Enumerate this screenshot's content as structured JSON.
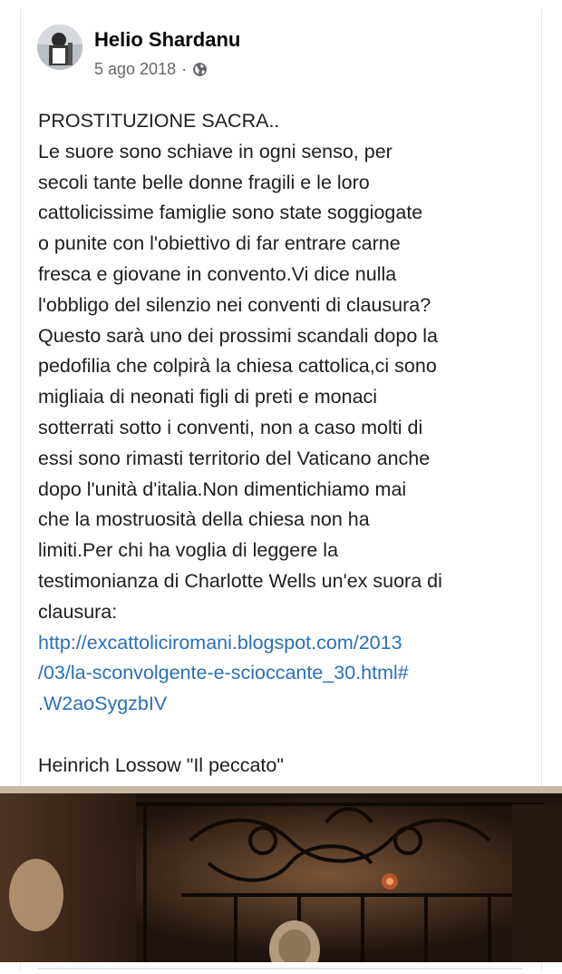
{
  "post": {
    "author": "Helio Shardanu",
    "date": "5 ago 2018",
    "separator": "·",
    "privacy_icon": "globe-icon",
    "text_lines": [
      "PROSTITUZIONE SACRA..",
      "Le suore sono schiave in ogni senso, per",
      "secoli tante belle donne fragili e le loro",
      "cattolicissime famiglie sono state soggiogate",
      "o punite con l'obiettivo di far entrare carne",
      "fresca e giovane in convento.Vi dice nulla",
      "l'obbligo del silenzio nei conventi di clausura?",
      "Questo sarà uno dei prossimi scandali dopo la",
      "pedofilia che colpirà la chiesa cattolica,ci sono",
      "migliaia di neonati figli di preti e monaci",
      "sotterrati sotto i conventi, non a caso molti di",
      "essi sono rimasti territorio del Vaticano anche",
      "dopo l'unità d'italia.Non dimentichiamo mai",
      "che la mostruosità della chiesa non ha",
      "limiti.Per chi ha voglia di leggere la",
      "testimonianza di Charlotte Wells un'ex suora di",
      "clausura:"
    ],
    "link_lines": [
      "http://excattoliciromani.blogspot.com/2013",
      "/03/la-sconvolgente-e-scioccante_30.html#",
      ".W2aoSygzbIV"
    ],
    "caption": "Heinrich Lossow \"Il peccato\""
  },
  "colors": {
    "link": "#2a6fb8",
    "text": "#1c1e21",
    "meta": "#65676b"
  }
}
